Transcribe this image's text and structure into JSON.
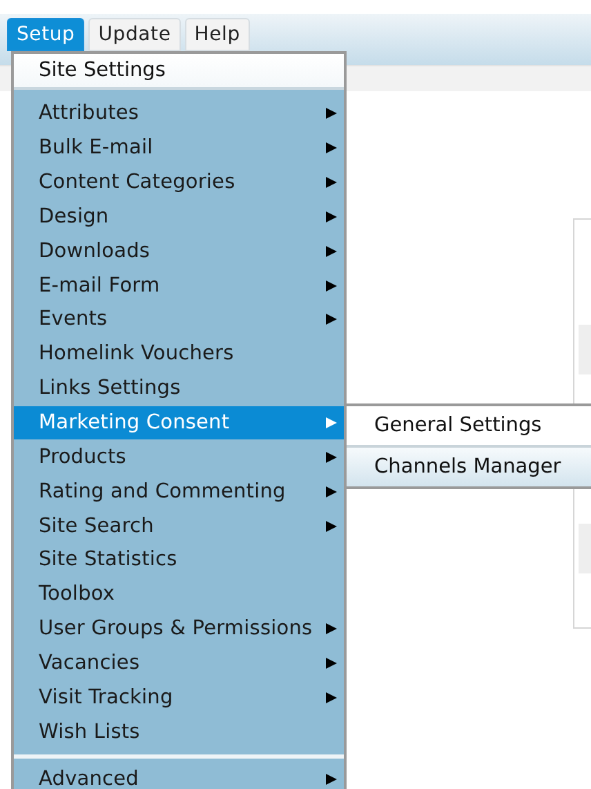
{
  "menu_bar": {
    "tabs": [
      {
        "label": "Setup",
        "selected": true
      },
      {
        "label": "Update",
        "selected": false
      },
      {
        "label": "Help",
        "selected": false
      }
    ]
  },
  "setup_menu": {
    "top_item": {
      "label": "Site Settings"
    },
    "items": [
      {
        "label": "Attributes",
        "has_submenu": true,
        "selected": false
      },
      {
        "label": "Bulk E-mail",
        "has_submenu": true,
        "selected": false
      },
      {
        "label": "Content Categories",
        "has_submenu": true,
        "selected": false
      },
      {
        "label": "Design",
        "has_submenu": true,
        "selected": false
      },
      {
        "label": "Downloads",
        "has_submenu": true,
        "selected": false
      },
      {
        "label": "E-mail Form",
        "has_submenu": true,
        "selected": false
      },
      {
        "label": "Events",
        "has_submenu": true,
        "selected": false
      },
      {
        "label": "Homelink Vouchers",
        "has_submenu": false,
        "selected": false
      },
      {
        "label": "Links Settings",
        "has_submenu": false,
        "selected": false
      },
      {
        "label": "Marketing Consent",
        "has_submenu": true,
        "selected": true
      },
      {
        "label": "Products",
        "has_submenu": true,
        "selected": false
      },
      {
        "label": "Rating and Commenting",
        "has_submenu": true,
        "selected": false
      },
      {
        "label": "Site Search",
        "has_submenu": true,
        "selected": false
      },
      {
        "label": "Site Statistics",
        "has_submenu": false,
        "selected": false
      },
      {
        "label": "Toolbox",
        "has_submenu": false,
        "selected": false
      },
      {
        "label": "User Groups & Permissions",
        "has_submenu": true,
        "selected": false
      },
      {
        "label": "Vacancies",
        "has_submenu": true,
        "selected": false
      },
      {
        "label": "Visit Tracking",
        "has_submenu": true,
        "selected": false
      },
      {
        "label": "Wish Lists",
        "has_submenu": false,
        "selected": false
      }
    ],
    "bottom_items": [
      {
        "label": "Advanced",
        "has_submenu": true,
        "selected": false
      }
    ]
  },
  "submenu": {
    "items": [
      {
        "label": "General Settings",
        "hovered": false
      },
      {
        "label": "Channels Manager",
        "hovered": true
      }
    ]
  }
}
